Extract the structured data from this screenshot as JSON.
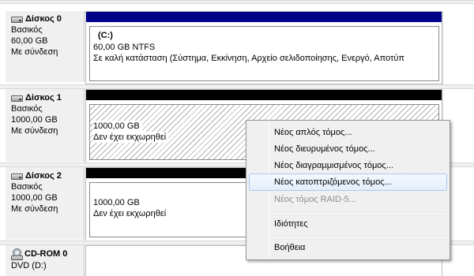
{
  "disks": [
    {
      "name": "Δίσκος 0",
      "type": "Βασικός",
      "size": "60,00 GB",
      "status": "Με σύνδεση",
      "partition": {
        "label": "(C:)",
        "size_fs": "60,00 GB NTFS",
        "health": "Σε καλή κατάσταση (Σύστημα, Εκκίνηση, Αρχείο σελιδοποίησης, Ενεργό, Αποτύπ"
      }
    },
    {
      "name": "Δίσκος 1",
      "type": "Βασικός",
      "size": "1000,00 GB",
      "status": "Με σύνδεση",
      "partition": {
        "size": "1000,00 GB",
        "state": "Δεν έχει εκχωρηθεί"
      }
    },
    {
      "name": "Δίσκος 2",
      "type": "Βασικός",
      "size": "1000,00 GB",
      "status": "Με σύνδεση",
      "partition": {
        "size": "1000,00 GB",
        "state": "Δεν έχει εκχωρηθεί"
      }
    }
  ],
  "cdrom": {
    "name": "CD-ROM 0",
    "drive": "DVD (D:)"
  },
  "context_menu": {
    "items": [
      {
        "label": "Νέος απλός τόμος..."
      },
      {
        "label": "Νέος διευρυμένος τόμος..."
      },
      {
        "label": "Νέος διαγραμμισμένος τόμος..."
      },
      {
        "label": "Νέος κατοπτριζόμενος τόμος..."
      },
      {
        "label": "Νέος τόμος RAID-5..."
      },
      {
        "label": "Ιδιότητες"
      },
      {
        "label": "Βοήθεια"
      }
    ]
  },
  "colors": {
    "primary_partition_bar": "#00008b",
    "unallocated_bar": "#000000",
    "menu_highlight_border": "#a8c8f0"
  }
}
